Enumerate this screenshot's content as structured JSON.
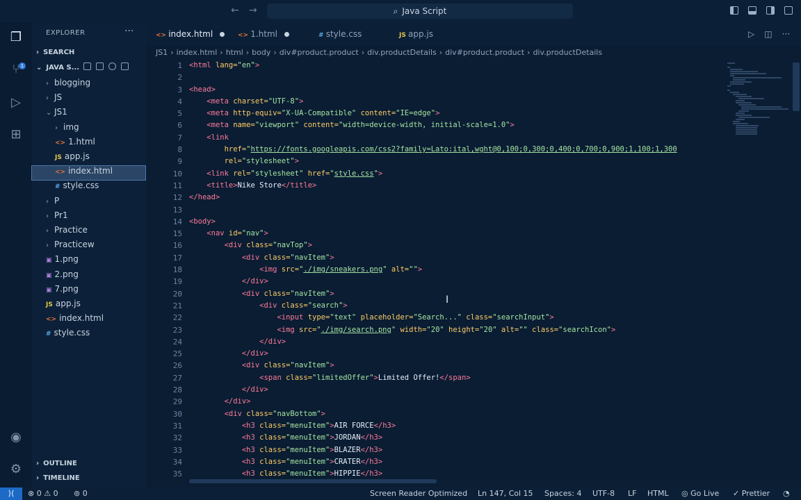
{
  "window": {
    "command_center": "Java Script"
  },
  "activity": {
    "explorer_badge": "1"
  },
  "sidebar": {
    "title": "EXPLORER",
    "search_label": "SEARCH",
    "workspace_label": "JAVA S...",
    "outline_label": "OUTLINE",
    "timeline_label": "TIMELINE",
    "tree": [
      {
        "label": "blogging",
        "type": "folder",
        "state": "collapsed",
        "depth": 1
      },
      {
        "label": "JS",
        "type": "folder",
        "state": "collapsed",
        "depth": 1
      },
      {
        "label": "JS1",
        "type": "folder",
        "state": "expanded",
        "depth": 1
      },
      {
        "label": "img",
        "type": "folder",
        "state": "collapsed",
        "depth": 2
      },
      {
        "label": "1.html",
        "type": "html",
        "depth": 2
      },
      {
        "label": "app.js",
        "type": "js",
        "depth": 2
      },
      {
        "label": "index.html",
        "type": "html",
        "depth": 2,
        "selected": true
      },
      {
        "label": "style.css",
        "type": "css",
        "depth": 2
      },
      {
        "label": "P",
        "type": "folder",
        "state": "collapsed",
        "depth": 1
      },
      {
        "label": "Pr1",
        "type": "folder",
        "state": "collapsed",
        "depth": 1
      },
      {
        "label": "Practice",
        "type": "folder",
        "state": "collapsed",
        "depth": 1
      },
      {
        "label": "Practicew",
        "type": "folder",
        "state": "collapsed",
        "depth": 1
      },
      {
        "label": "1.png",
        "type": "img",
        "depth": 1
      },
      {
        "label": "2.png",
        "type": "img",
        "depth": 1
      },
      {
        "label": "7.png",
        "type": "img",
        "depth": 1
      },
      {
        "label": "app.js",
        "type": "js",
        "depth": 1
      },
      {
        "label": "index.html",
        "type": "html",
        "depth": 1
      },
      {
        "label": "style.css",
        "type": "css",
        "depth": 1
      }
    ]
  },
  "tabs": [
    {
      "label": "index.html",
      "icon": "<>",
      "active": true,
      "modified": true
    },
    {
      "label": "1.html",
      "icon": "<>",
      "active": false,
      "modified": true
    },
    {
      "label": "style.css",
      "icon": "#",
      "active": false,
      "modified": false
    },
    {
      "label": "app.js",
      "icon": "JS",
      "active": false,
      "modified": false
    }
  ],
  "breadcrumbs": [
    "JS1",
    "index.html",
    "html",
    "body",
    "div#product.product",
    "div.productDetails",
    "div#product.product",
    "div.productDetails"
  ],
  "code_lines": [
    [
      [
        "tg",
        "<html "
      ],
      [
        "at",
        "lang="
      ],
      [
        "st",
        "\"en\""
      ],
      [
        "tg",
        ">"
      ]
    ],
    [],
    [
      [
        "tg",
        "<head>"
      ]
    ],
    [
      [
        "tx",
        "    "
      ],
      [
        "tg",
        "<meta "
      ],
      [
        "at",
        "charset="
      ],
      [
        "st",
        "\"UTF-8\""
      ],
      [
        "tg",
        ">"
      ]
    ],
    [
      [
        "tx",
        "    "
      ],
      [
        "tg",
        "<meta "
      ],
      [
        "at",
        "http-equiv="
      ],
      [
        "st",
        "\"X-UA-Compatible\" "
      ],
      [
        "at",
        "content="
      ],
      [
        "st",
        "\"IE=edge\""
      ],
      [
        "tg",
        ">"
      ]
    ],
    [
      [
        "tx",
        "    "
      ],
      [
        "tg",
        "<meta "
      ],
      [
        "at",
        "name="
      ],
      [
        "st",
        "\"viewport\" "
      ],
      [
        "at",
        "content="
      ],
      [
        "st",
        "\"width=device-width, initial-scale=1.0\""
      ],
      [
        "tg",
        ">"
      ]
    ],
    [
      [
        "tx",
        "    "
      ],
      [
        "tg",
        "<link"
      ]
    ],
    [
      [
        "tx",
        "        "
      ],
      [
        "at",
        "href="
      ],
      [
        "st",
        "\""
      ],
      [
        "lk",
        "https://fonts.googleapis.com/css2?family=Lato:ital,wght@0,100;0,300;0,400;0,700;0,900;1,100;1,300"
      ]
    ],
    [
      [
        "tx",
        "        "
      ],
      [
        "at",
        "rel="
      ],
      [
        "st",
        "\"stylesheet\""
      ],
      [
        "tg",
        ">"
      ]
    ],
    [
      [
        "tx",
        "    "
      ],
      [
        "tg",
        "<link "
      ],
      [
        "at",
        "rel="
      ],
      [
        "st",
        "\"stylesheet\" "
      ],
      [
        "at",
        "href="
      ],
      [
        "st",
        "\""
      ],
      [
        "lk",
        "style.css"
      ],
      [
        "st",
        "\""
      ],
      [
        "tg",
        ">"
      ]
    ],
    [
      [
        "tx",
        "    "
      ],
      [
        "tg",
        "<title>"
      ],
      [
        "tx",
        "Nike Store"
      ],
      [
        "tg",
        "</title>"
      ]
    ],
    [
      [
        "tg",
        "</head>"
      ]
    ],
    [],
    [
      [
        "tg",
        "<body>"
      ]
    ],
    [
      [
        "tx",
        "    "
      ],
      [
        "tg",
        "<nav "
      ],
      [
        "at",
        "id="
      ],
      [
        "st",
        "\"nav\""
      ],
      [
        "tg",
        ">"
      ]
    ],
    [
      [
        "tx",
        "        "
      ],
      [
        "tg",
        "<div "
      ],
      [
        "at",
        "class="
      ],
      [
        "st",
        "\"navTop\""
      ],
      [
        "tg",
        ">"
      ]
    ],
    [
      [
        "tx",
        "            "
      ],
      [
        "tg",
        "<div "
      ],
      [
        "at",
        "class="
      ],
      [
        "st",
        "\"navItem\""
      ],
      [
        "tg",
        ">"
      ]
    ],
    [
      [
        "tx",
        "                "
      ],
      [
        "tg",
        "<img "
      ],
      [
        "at",
        "src="
      ],
      [
        "st",
        "\""
      ],
      [
        "lk",
        "./img/sneakers.png"
      ],
      [
        "st",
        "\" "
      ],
      [
        "at",
        "alt="
      ],
      [
        "st",
        "\"\""
      ],
      [
        "tg",
        ">"
      ]
    ],
    [
      [
        "tx",
        "            "
      ],
      [
        "tg",
        "</div>"
      ]
    ],
    [
      [
        "tx",
        "            "
      ],
      [
        "tg",
        "<div "
      ],
      [
        "at",
        "class="
      ],
      [
        "st",
        "\"navItem\""
      ],
      [
        "tg",
        ">"
      ]
    ],
    [
      [
        "tx",
        "                "
      ],
      [
        "tg",
        "<div "
      ],
      [
        "at",
        "class="
      ],
      [
        "st",
        "\"search\""
      ],
      [
        "tg",
        ">"
      ]
    ],
    [
      [
        "tx",
        "                    "
      ],
      [
        "tg",
        "<input "
      ],
      [
        "at",
        "type="
      ],
      [
        "st",
        "\"text\" "
      ],
      [
        "at",
        "placeholder="
      ],
      [
        "st",
        "\"Search...\" "
      ],
      [
        "at",
        "class="
      ],
      [
        "st",
        "\"searchInput\""
      ],
      [
        "tg",
        ">"
      ]
    ],
    [
      [
        "tx",
        "                    "
      ],
      [
        "tg",
        "<img "
      ],
      [
        "at",
        "src="
      ],
      [
        "st",
        "\""
      ],
      [
        "lk",
        "./img/search.png"
      ],
      [
        "st",
        "\" "
      ],
      [
        "at",
        "width="
      ],
      [
        "st",
        "\"20\" "
      ],
      [
        "at",
        "height="
      ],
      [
        "st",
        "\"20\" "
      ],
      [
        "at",
        "alt="
      ],
      [
        "st",
        "\"\" "
      ],
      [
        "at",
        "class="
      ],
      [
        "st",
        "\"searchIcon\""
      ],
      [
        "tg",
        ">"
      ]
    ],
    [
      [
        "tx",
        "                "
      ],
      [
        "tg",
        "</div>"
      ]
    ],
    [
      [
        "tx",
        "            "
      ],
      [
        "tg",
        "</div>"
      ]
    ],
    [
      [
        "tx",
        "            "
      ],
      [
        "tg",
        "<div "
      ],
      [
        "at",
        "class="
      ],
      [
        "st",
        "\"navItem\""
      ],
      [
        "tg",
        ">"
      ]
    ],
    [
      [
        "tx",
        "                "
      ],
      [
        "tg",
        "<span "
      ],
      [
        "at",
        "class="
      ],
      [
        "st",
        "\"limitedOffer\""
      ],
      [
        "tg",
        ">"
      ],
      [
        "tx",
        "Limited Offer!"
      ],
      [
        "tg",
        "</span>"
      ]
    ],
    [
      [
        "tx",
        "            "
      ],
      [
        "tg",
        "</div>"
      ]
    ],
    [
      [
        "tx",
        "        "
      ],
      [
        "tg",
        "</div>"
      ]
    ],
    [
      [
        "tx",
        "        "
      ],
      [
        "tg",
        "<div "
      ],
      [
        "at",
        "class="
      ],
      [
        "st",
        "\"navBottom\""
      ],
      [
        "tg",
        ">"
      ]
    ],
    [
      [
        "tx",
        "            "
      ],
      [
        "tg",
        "<h3 "
      ],
      [
        "at",
        "class="
      ],
      [
        "st",
        "\"menuItem\""
      ],
      [
        "tg",
        ">"
      ],
      [
        "tx",
        "AIR FORCE"
      ],
      [
        "tg",
        "</h3>"
      ]
    ],
    [
      [
        "tx",
        "            "
      ],
      [
        "tg",
        "<h3 "
      ],
      [
        "at",
        "class="
      ],
      [
        "st",
        "\"menuItem\""
      ],
      [
        "tg",
        ">"
      ],
      [
        "tx",
        "JORDAN"
      ],
      [
        "tg",
        "</h3>"
      ]
    ],
    [
      [
        "tx",
        "            "
      ],
      [
        "tg",
        "<h3 "
      ],
      [
        "at",
        "class="
      ],
      [
        "st",
        "\"menuItem\""
      ],
      [
        "tg",
        ">"
      ],
      [
        "tx",
        "BLAZER"
      ],
      [
        "tg",
        "</h3>"
      ]
    ],
    [
      [
        "tx",
        "            "
      ],
      [
        "tg",
        "<h3 "
      ],
      [
        "at",
        "class="
      ],
      [
        "st",
        "\"menuItem\""
      ],
      [
        "tg",
        ">"
      ],
      [
        "tx",
        "CRATER"
      ],
      [
        "tg",
        "</h3>"
      ]
    ],
    [
      [
        "tx",
        "            "
      ],
      [
        "tg",
        "<h3 "
      ],
      [
        "at",
        "class="
      ],
      [
        "st",
        "\"menuItem\""
      ],
      [
        "tg",
        ">"
      ],
      [
        "tx",
        "HIPPIE"
      ],
      [
        "tg",
        "</h3>"
      ]
    ]
  ],
  "status": {
    "errors": "0",
    "warnings": "0",
    "ports": "0",
    "screen_reader": "Screen Reader Optimized",
    "position": "Ln 147, Col 15",
    "spaces": "Spaces: 4",
    "encoding": "UTF-8",
    "eol": "LF",
    "language": "HTML",
    "go_live": "Go Live",
    "prettier": "Prettier"
  },
  "icons": {
    "files": "files-icon",
    "source_control": "source-control-icon",
    "run_debug": "run-debug-icon",
    "extensions": "extensions-icon",
    "account": "account-icon",
    "settings": "gear-icon",
    "bell": "bell-icon",
    "remote": "remote-icon"
  },
  "colors": {
    "accent": "#1c6ac6",
    "tag": "#ff7a98",
    "attr": "#ffcc66",
    "string": "#a6e3a1"
  }
}
